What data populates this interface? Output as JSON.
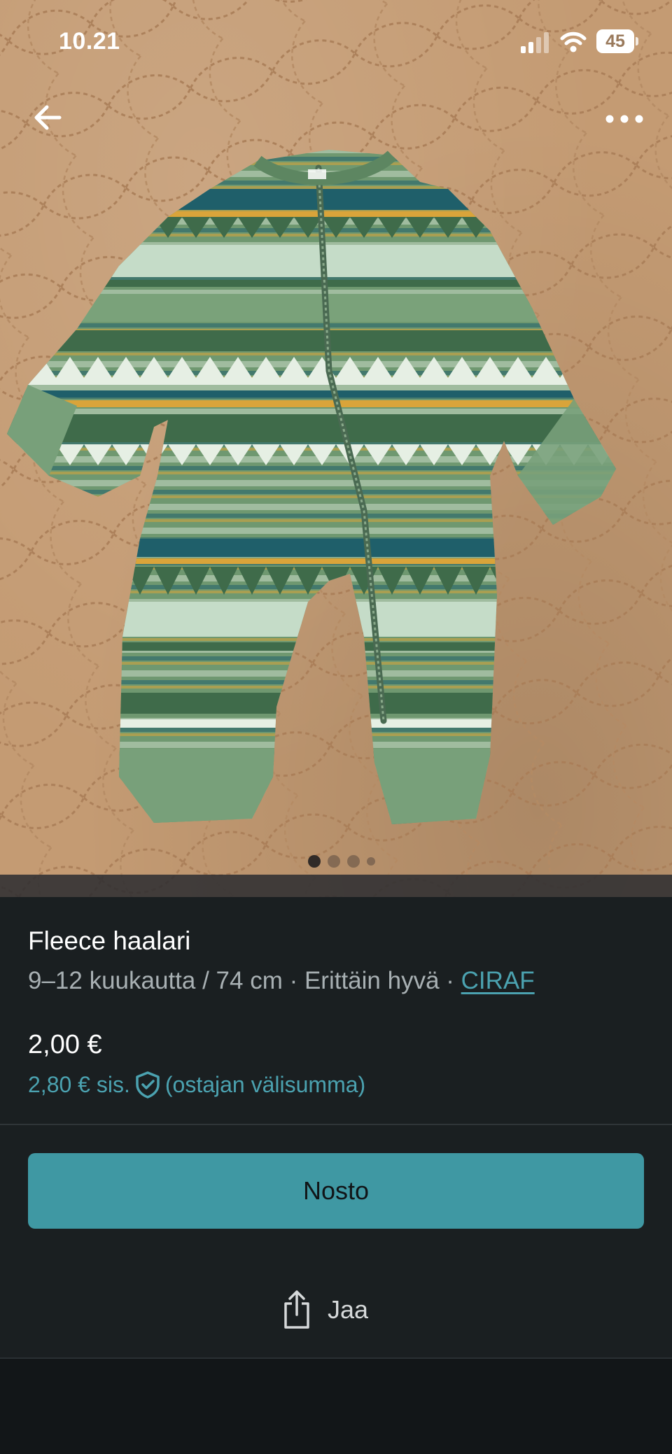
{
  "status_bar": {
    "time": "10.21",
    "battery": "45",
    "icons": [
      "signal-icon",
      "wifi-icon",
      "battery-icon"
    ]
  },
  "nav": {
    "back_icon": "arrow-left-icon",
    "more_icon": "more-horizontal-icon"
  },
  "gallery": {
    "image_count": 4,
    "active_index": 0
  },
  "item": {
    "title": "Fleece haalari",
    "size": "9–12 kuukautta / 74 cm",
    "separator": " · ",
    "condition": "Erittäin hyvä",
    "brand": "CIRAF",
    "price": "2,00 €",
    "price_incl": "2,80 € sis.",
    "price_incl_note": "(ostajan välisumma)"
  },
  "actions": {
    "primary_label": "Nosto",
    "share_label": "Jaa"
  },
  "colors": {
    "accent": "#3f98a3",
    "link": "#4ba2b0",
    "panel_bg": "#1a1f21",
    "text_secondary": "#a8b0b3",
    "photo_bg": "#c49b73",
    "garment_green": "#6f9870"
  }
}
